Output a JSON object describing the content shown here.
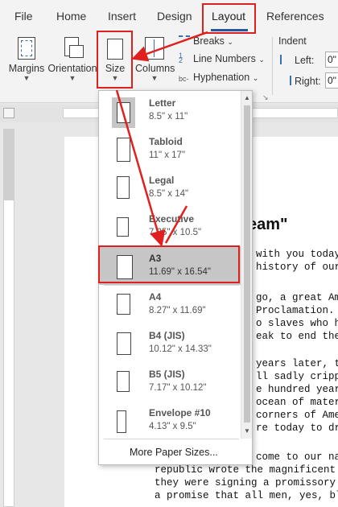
{
  "tabs": [
    {
      "label": "File"
    },
    {
      "label": "Home"
    },
    {
      "label": "Insert"
    },
    {
      "label": "Design"
    },
    {
      "label": "Layout"
    },
    {
      "label": "References"
    }
  ],
  "ribbon": {
    "margins": "Margins",
    "orientation": "Orientation",
    "size": "Size",
    "columns": "Columns",
    "breaks": "Breaks",
    "line_numbers": "Line Numbers",
    "hyphenation": "Hyphenation",
    "indent": "Indent",
    "left": "Left:",
    "right": "Right:",
    "left_value": "0\"",
    "right_value": "0\""
  },
  "dropdown": {
    "items": [
      {
        "name": "Letter",
        "size": "8.5\" x 11\""
      },
      {
        "name": "Tabloid",
        "size": "11\" x 17\""
      },
      {
        "name": "Legal",
        "size": "8.5\" x 14\""
      },
      {
        "name": "Executive",
        "size": "7.25\" x 10.5\""
      },
      {
        "name": "A3",
        "size": "11.69\" x 16.54\""
      },
      {
        "name": "A4",
        "size": "8.27\" x 11.69\""
      },
      {
        "name": "B4 (JIS)",
        "size": "10.12\" x 14.33\""
      },
      {
        "name": "B5 (JIS)",
        "size": "7.17\" x 10.12\""
      },
      {
        "name": "Envelope #10",
        "size": "4.13\" x 9.5\""
      }
    ],
    "more": "More Paper Sizes..."
  },
  "document": {
    "title": "eam\"",
    "lines": [
      "with you today i",
      "history of our n",
      "go, a great Am",
      "Proclamation. T",
      "o slaves who h",
      "eak to end the l",
      "years later, the",
      "ll sadly crippl",
      "e hundred year",
      "ocean of materi",
      "corners of Ame",
      "re today to dram",
      "come to our na",
      "republic wrote the magnificent wo",
      "they were signing a promissory n",
      "a promise that all men, yes, bla"
    ]
  },
  "colors": {
    "annotation": "#e0201e",
    "accent": "#2b579a"
  }
}
